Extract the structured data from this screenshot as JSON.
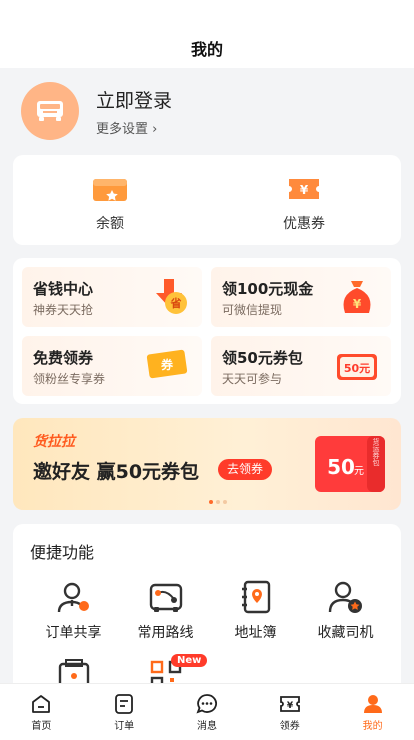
{
  "header": {
    "title": "我的"
  },
  "profile": {
    "login_label": "立即登录",
    "more_settings": "更多设置 ›"
  },
  "wallet": {
    "items": [
      {
        "label": "余额",
        "icon": "wallet-icon"
      },
      {
        "label": "优惠券",
        "icon": "coupon-icon"
      }
    ]
  },
  "promos": {
    "items": [
      {
        "title": "省钱中心",
        "subtitle": "神券天天抢",
        "icon": "savings-center-icon"
      },
      {
        "title": "领100元现金",
        "subtitle": "可微信提现",
        "icon": "money-bag-icon"
      },
      {
        "title": "免费领券",
        "subtitle": "领粉丝专享券",
        "icon": "ticket-icon"
      },
      {
        "title": "领50元券包",
        "subtitle": "天天可参与",
        "icon": "coupon-pack-icon"
      }
    ]
  },
  "banner": {
    "brand": "货拉拉",
    "headline": "邀好友 赢50元券包",
    "cta": "去领券",
    "coupon_amount": "50",
    "coupon_unit": "元",
    "coupon_side": "货运券包",
    "page_count": 3,
    "active_page": 1
  },
  "quick_functions": {
    "title": "便捷功能",
    "items": [
      {
        "label": "订单共享",
        "icon": "order-share-icon"
      },
      {
        "label": "常用路线",
        "icon": "route-icon"
      },
      {
        "label": "地址簿",
        "icon": "address-book-icon"
      },
      {
        "label": "收藏司机",
        "icon": "favorite-driver-icon"
      }
    ],
    "extra_badge": "New"
  },
  "tabbar": {
    "items": [
      {
        "label": "首页",
        "icon": "home-icon"
      },
      {
        "label": "订单",
        "icon": "order-icon"
      },
      {
        "label": "消息",
        "icon": "message-icon"
      },
      {
        "label": "领券",
        "icon": "coupon-tab-icon"
      },
      {
        "label": "我的",
        "icon": "profile-icon",
        "active": true
      }
    ]
  },
  "colors": {
    "accent": "#ff6a1a",
    "cta": "#ff3b2a",
    "avatar_bg": "#ffb586"
  }
}
